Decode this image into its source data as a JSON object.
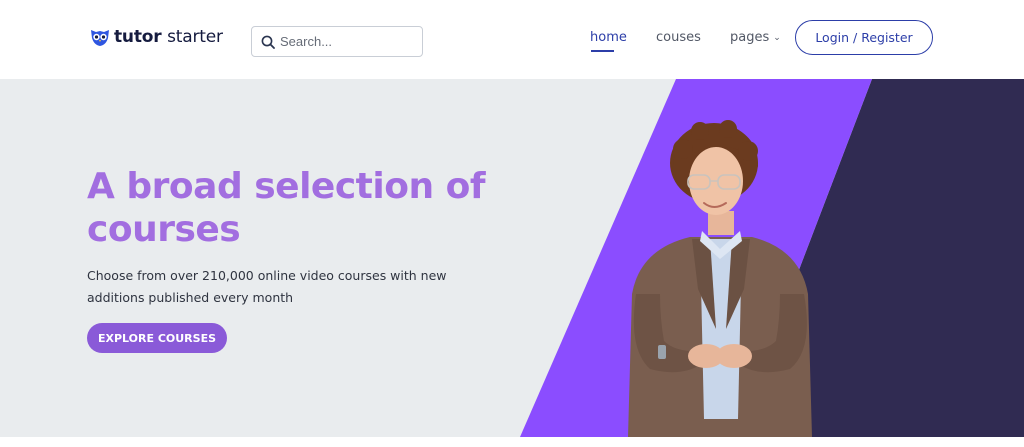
{
  "brand": {
    "name_bold": "tutor",
    "name_light": "starter"
  },
  "search": {
    "placeholder": "Search..."
  },
  "nav": {
    "items": [
      {
        "label": "home",
        "active": true
      },
      {
        "label": "couses",
        "active": false
      },
      {
        "label": "pages",
        "active": false
      }
    ],
    "login_label": "Login / Register"
  },
  "hero": {
    "headline_line1": "A broad selection of",
    "headline_line2": "courses",
    "subtitle": "Choose from over 210,000 online video courses with new additions published every month",
    "cta_label": "EXPLORE COURSES"
  },
  "colors": {
    "accent": "#2c3ea8",
    "headline": "#a26ee0",
    "cta": "#8a5ad8",
    "stripe_purple": "#8b4dff",
    "stripe_dark": "#302b52",
    "hero_bg": "#e9ecee"
  },
  "icons": [
    "owl-logo-icon",
    "search-icon",
    "chevron-down-icon"
  ]
}
